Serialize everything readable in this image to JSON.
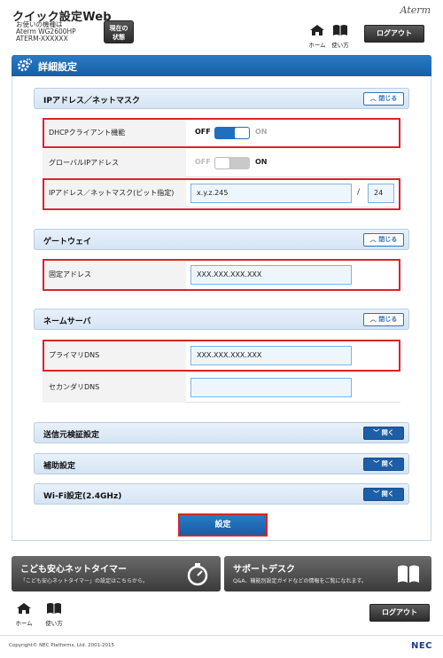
{
  "header": {
    "app_title": "クイック設定Web",
    "model_caption": "お使いの機種は",
    "model_name": "Aterm WG2600HP",
    "model_id": "ATERM-XXXXXX",
    "status_button_line1": "現在の",
    "status_button_line2": "状態",
    "brand": "Aterm",
    "home_label": "ホーム",
    "help_label": "使い方",
    "logout_label": "ログアウト"
  },
  "page": {
    "title": "詳細設定"
  },
  "sections": {
    "ip": {
      "title": "IPアドレス／ネットマスク",
      "toggle_label": "閉じる",
      "dhcp_label": "DHCPクライアント機能",
      "dhcp_off": "OFF",
      "dhcp_on": "ON",
      "global_ip_label": "グローバルIPアドレス",
      "global_off": "OFF",
      "global_on": "ON",
      "ipmask_label": "IPアドレス／ネットマスク(ビット指定)",
      "ip_value": "x.y.z.245",
      "slash": "/",
      "mask_value": "24"
    },
    "gateway": {
      "title": "ゲートウェイ",
      "toggle_label": "閉じる",
      "fixed_label": "固定アドレス",
      "fixed_value": "XXX.XXX.XXX.XXX"
    },
    "nameserver": {
      "title": "ネームサーバ",
      "toggle_label": "閉じる",
      "primary_label": "プライマリDNS",
      "primary_value": "XXX.XXX.XXX.XXX",
      "secondary_label": "セカンダリDNS",
      "secondary_value": ""
    },
    "source_verify": {
      "title": "送信元検証設定",
      "toggle_label": "開く"
    },
    "aux": {
      "title": "補助設定",
      "toggle_label": "開く"
    },
    "wifi": {
      "title": "Wi-Fi設定(2.4GHz)",
      "toggle_label": "開く"
    }
  },
  "submit_label": "設定",
  "banners": {
    "kids": {
      "title": "こども安心ネットタイマー",
      "sub": "「こども安心ネットタイマー」の設定はこちらから。"
    },
    "support": {
      "title": "サポートデスク",
      "sub": "Q&A、機能別設定ガイドなどの情報をご覧になれます。"
    }
  },
  "footer": {
    "home_label": "ホーム",
    "help_label": "使い方",
    "logout_label": "ログアウト",
    "copyright": "Copyright© NEC Platforms, Ltd. 2001-2015",
    "nec": "NEC"
  },
  "colors": {
    "accent_blue": "#1c5ea7",
    "highlight_red": "#d9242b",
    "toggle_on_blue": "#1f6fc0"
  }
}
